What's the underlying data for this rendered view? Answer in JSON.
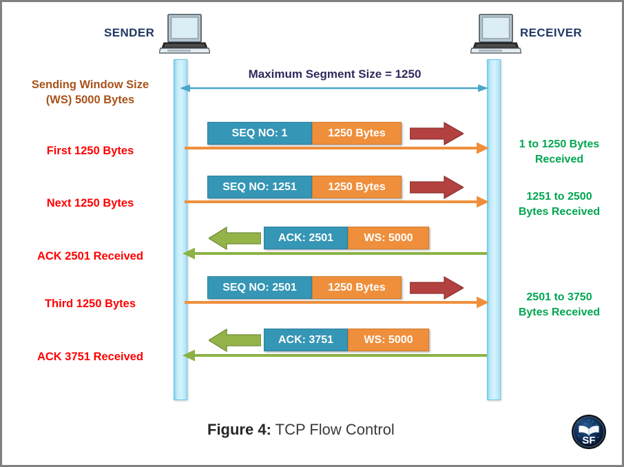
{
  "figure": {
    "caption_prefix": "Figure 4:",
    "caption_title": "TCP Flow Control"
  },
  "endpoints": {
    "sender": "SENDER",
    "receiver": "RECEIVER",
    "sender_icon": "laptop-icon",
    "receiver_icon": "laptop-icon"
  },
  "mss": {
    "label": "Maximum Segment Size = 1250",
    "arrow": "double-headed-arrow",
    "color": "#4ba6c9"
  },
  "left_labels": [
    {
      "text": "Sending Window Size\n(WS) 5000 Bytes",
      "color": "#a8521a",
      "style": "brown"
    },
    {
      "text": "First 1250 Bytes",
      "color": "#ff0000",
      "style": "red"
    },
    {
      "text": "Next 1250 Bytes",
      "color": "#ff0000",
      "style": "red"
    },
    {
      "text": "ACK 2501 Received",
      "color": "#ff0000",
      "style": "red"
    },
    {
      "text": "Third 1250 Bytes",
      "color": "#ff0000",
      "style": "red"
    },
    {
      "text": "ACK 3751 Received",
      "color": "#ff0000",
      "style": "red"
    }
  ],
  "right_labels": [
    {
      "text": "1 to 1250 Bytes\nReceived",
      "color": "#00a550"
    },
    {
      "text": "1251 to 2500\nBytes Received",
      "color": "#00a550"
    },
    {
      "text": "2501 to 3750\nBytes Received",
      "color": "#00a550"
    }
  ],
  "messages": [
    {
      "direction": "sender-to-receiver",
      "left_field": "SEQ NO: 1",
      "right_field": "1250 Bytes",
      "line_color": "#ef8f3c",
      "block_arrow_color": "#b3413f"
    },
    {
      "direction": "sender-to-receiver",
      "left_field": "SEQ NO: 1251",
      "right_field": "1250 Bytes",
      "line_color": "#ef8f3c",
      "block_arrow_color": "#b3413f"
    },
    {
      "direction": "receiver-to-sender",
      "left_field": "ACK: 2501",
      "right_field": "WS: 5000",
      "line_color": "#8cb244",
      "block_arrow_color": "#94b44a"
    },
    {
      "direction": "sender-to-receiver",
      "left_field": "SEQ NO: 2501",
      "right_field": "1250 Bytes",
      "line_color": "#ef8f3c",
      "block_arrow_color": "#b3413f"
    },
    {
      "direction": "receiver-to-sender",
      "left_field": "ACK: 3751",
      "right_field": "WS: 5000",
      "line_color": "#8cb244",
      "block_arrow_color": "#94b44a"
    }
  ],
  "logo": {
    "name": "sf-logo",
    "text": "SF"
  },
  "colors": {
    "teal_field": "#3596b5",
    "orange_field": "#ef8f3c",
    "lifeline": "#bfeaf9",
    "red_block_arrow": "#b3413f",
    "green_block_arrow": "#94b44a",
    "green_text": "#00a550",
    "red_text": "#ff0000",
    "brown_text": "#a8521a",
    "navy_text": "#1f3864",
    "border": "#808080"
  }
}
